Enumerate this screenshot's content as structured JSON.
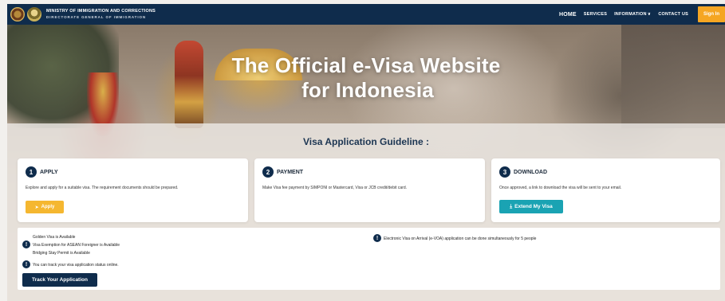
{
  "header": {
    "ministry_line1": "MINISTRY OF IMMIGRATION AND CORRECTIONS",
    "ministry_line2": "DIRECTORATE GENERAL OF IMMIGRATION",
    "nav": {
      "home": "HOME",
      "services": "SERVICES",
      "information": "INFORMATION",
      "contact": "CONTACT US"
    },
    "sign_in": "Sign In",
    "background_color": "#0f2c4c",
    "sign_in_color": "#f5a623"
  },
  "hero": {
    "title_line1": "The Official e-Visa Website",
    "title_line2": "for Indonesia"
  },
  "guideline": {
    "title": "Visa Application Guideline :",
    "steps": [
      {
        "number": "1",
        "title": "APPLY",
        "description": "Explore and apply for a suitable visa. The requirement documents should be prepared.",
        "button": "Apply",
        "button_icon": "send-icon",
        "button_color": "#f5b730"
      },
      {
        "number": "2",
        "title": "PAYMENT",
        "description": "Make Visa fee payment by SIMPONI or Mastercard, Visa or JCB credit/debit card."
      },
      {
        "number": "3",
        "title": "DOWNLOAD",
        "description": "Once approved, a link to download the visa will be sent to your email.",
        "button": "Extend My Visa",
        "button_icon": "download-icon",
        "button_color": "#1aa3b3"
      }
    ]
  },
  "info": {
    "lines": [
      "Golden Visa is Available",
      "Visa Exemption for ASEAN Foreigner is Available",
      "Bridging Stay Permit is Available"
    ],
    "track_notice": "You can track your visa application status online.",
    "voa_notice": "Electronic Visa on Arrival (e-VOA) application can be done simultaneously for 5 people",
    "track_button": "Track Your Application",
    "icon": "exclamation-icon"
  }
}
